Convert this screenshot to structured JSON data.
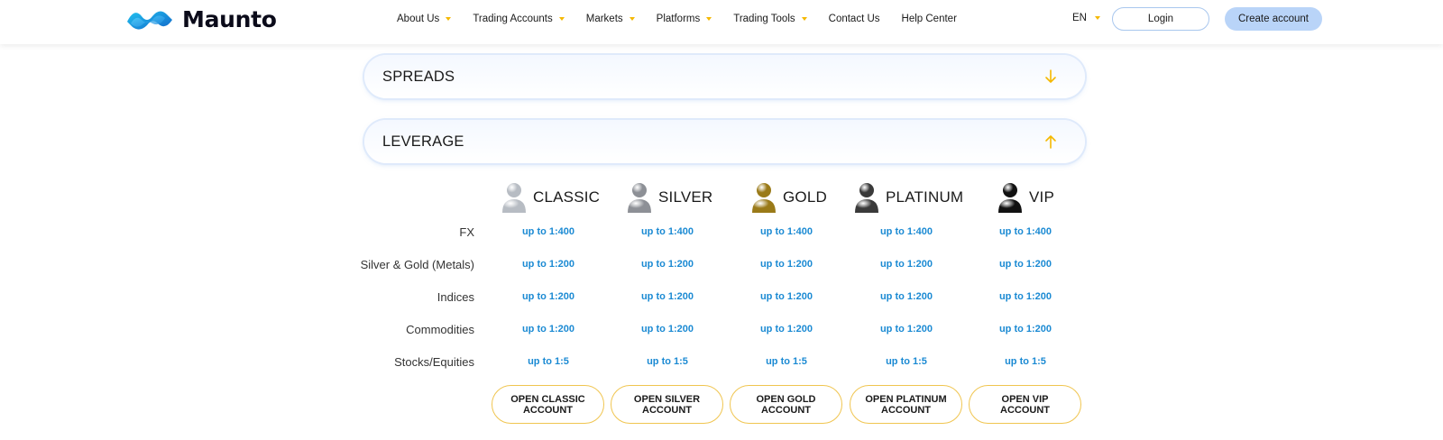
{
  "header": {
    "logo_text": "Maunto",
    "nav": [
      {
        "label": "About Us",
        "dropdown": true
      },
      {
        "label": "Trading Accounts",
        "dropdown": true
      },
      {
        "label": "Markets",
        "dropdown": true
      },
      {
        "label": "Platforms",
        "dropdown": true
      },
      {
        "label": "Trading Tools",
        "dropdown": true
      },
      {
        "label": "Contact Us",
        "dropdown": false
      },
      {
        "label": "Help Center",
        "dropdown": false
      }
    ],
    "language": "EN",
    "login_label": "Login",
    "create_label": "Create account"
  },
  "accordions": {
    "spreads": {
      "title": "SPREADS",
      "state": "collapsed"
    },
    "leverage": {
      "title": "LEVERAGE",
      "state": "expanded"
    }
  },
  "tiers": [
    {
      "name": "CLASSIC",
      "color": "#b7bcc3",
      "button": "OPEN CLASSIC ACCOUNT",
      "button_lines": [
        "OPEN CLASSIC",
        "ACCOUNT"
      ]
    },
    {
      "name": "SILVER",
      "color": "#8d9096",
      "button": "OPEN SILVER ACCOUNT",
      "button_lines": [
        "OPEN SILVER",
        "ACCOUNT"
      ]
    },
    {
      "name": "GOLD",
      "color": "#9a7a18",
      "button": "OPEN GOLD ACCOUNT",
      "button_lines": [
        "OPEN GOLD",
        "ACCOUNT"
      ]
    },
    {
      "name": "PLATINUM",
      "color": "#3a3a3a",
      "button": "OPEN PLATINUM ACCOUNT",
      "button_lines": [
        "OPEN PLATINUM",
        "ACCOUNT"
      ]
    },
    {
      "name": "VIP",
      "color": "#111111",
      "button": "OPEN VIP ACCOUNT",
      "button_lines": [
        "OPEN VIP",
        "ACCOUNT"
      ]
    }
  ],
  "leverage_table": {
    "rows": [
      {
        "label": "FX",
        "values": [
          "up to 1:400",
          "up to 1:400",
          "up to 1:400",
          "up to 1:400",
          "up to 1:400"
        ]
      },
      {
        "label": "Silver & Gold (Metals)",
        "values": [
          "up to 1:200",
          "up to 1:200",
          "up to 1:200",
          "up to 1:200",
          "up to 1:200"
        ]
      },
      {
        "label": "Indices",
        "values": [
          "up to 1:200",
          "up to 1:200",
          "up to 1:200",
          "up to 1:200",
          "up to 1:200"
        ]
      },
      {
        "label": "Commodities",
        "values": [
          "up to 1:200",
          "up to 1:200",
          "up to 1:200",
          "up to 1:200",
          "up to 1:200"
        ]
      },
      {
        "label": "Stocks/Equities",
        "values": [
          "up to 1:5",
          "up to 1:5",
          "up to 1:5",
          "up to 1:5",
          "up to 1:5"
        ]
      }
    ]
  },
  "colors": {
    "accent_yellow": "#f5b800",
    "value_blue": "#1b8ad3",
    "create_button": "#b9d4f8",
    "logo_blue": "#1aa8e8"
  },
  "icons": {
    "logo": "maunto-wave-logo",
    "caret": "caret-down-icon",
    "spreads_arrow": "arrow-down-icon",
    "leverage_arrow": "arrow-up-icon",
    "tier_avatar": "user-avatar-icon"
  }
}
